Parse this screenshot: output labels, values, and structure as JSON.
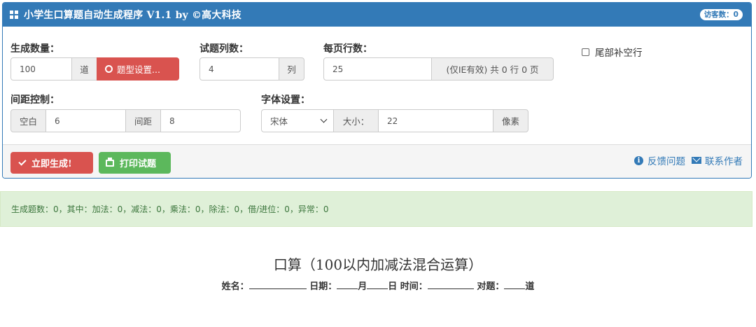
{
  "header": {
    "title": "小学生口算题自动生成程序 V1.1 by ©高大科技",
    "visitor_badge": "访客数：0"
  },
  "form": {
    "count": {
      "label": "生成数量：",
      "value": "100",
      "unit": "道",
      "type_button": "题型设置..."
    },
    "columns": {
      "label": "试题列数：",
      "value": "4",
      "unit": "列"
    },
    "rows_per_page": {
      "label": "每页行数：",
      "value": "25",
      "note": "(仅IE有效) 共 0 行 0 页"
    },
    "pad_rows": {
      "label": "尾部补空行",
      "checked": false
    },
    "spacing": {
      "label": "间距控制：",
      "blank_label": "空白",
      "blank_value": "6",
      "gap_label": "间距",
      "gap_value": "8"
    },
    "font": {
      "label": "字体设置：",
      "family": "宋体",
      "size_label": "大小：",
      "size_value": "22",
      "unit": "像素"
    }
  },
  "footer": {
    "generate_button": "立即生成!",
    "print_button": "打印试题",
    "feedback_link": "反馈问题",
    "contact_link": "联系作者"
  },
  "stats": {
    "text": "生成题数：0，其中：加法：0，减法：0，乘法：0，除法：0，借/进位：0，异常：0"
  },
  "sheet": {
    "title": "口算（100以内加减法混合运算）",
    "name_label": "姓名：",
    "date_label": "日期：",
    "month_label": "月",
    "day_label": "日",
    "time_label": "时间：",
    "correct_label": "对题：",
    "correct_unit": "道"
  },
  "colors": {
    "primary": "#337ab7",
    "danger": "#d9534f",
    "success": "#5cb85c",
    "alert_bg": "#dff0d8"
  }
}
